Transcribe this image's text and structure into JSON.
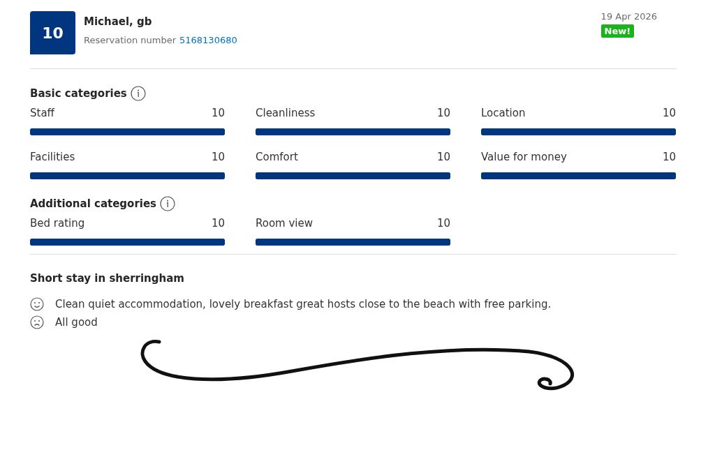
{
  "review": {
    "score": "10",
    "name": "Michael, gb",
    "reservation_label": "Reservation number",
    "reservation_number": "5168130680",
    "date": "19 Apr 2026",
    "badge": "New!"
  },
  "sections": [
    {
      "title": "Basic categories",
      "ratings": [
        {
          "label": "Staff",
          "score": "10",
          "level": 1
        },
        {
          "label": "Cleanliness",
          "score": "10",
          "level": 1
        },
        {
          "label": "Location",
          "score": "10",
          "level": 1
        },
        {
          "label": "Facilities",
          "score": "10",
          "level": 1
        },
        {
          "label": "Comfort",
          "score": "10",
          "level": 1
        },
        {
          "label": "Value for money",
          "score": "10",
          "level": 1
        }
      ]
    },
    {
      "title": "Additional categories",
      "ratings": [
        {
          "label": "Bed rating",
          "score": "10",
          "level": 1
        },
        {
          "label": "Room view",
          "score": "10",
          "level": 1
        }
      ]
    }
  ],
  "comment": {
    "title": "Short stay in sherringham",
    "lines": [
      {
        "kind": "positive",
        "text": "Clean quiet accommodation, lovely breakfast great hosts close to the beach with free parking."
      },
      {
        "kind": "negative",
        "text": "All good"
      }
    ]
  }
}
